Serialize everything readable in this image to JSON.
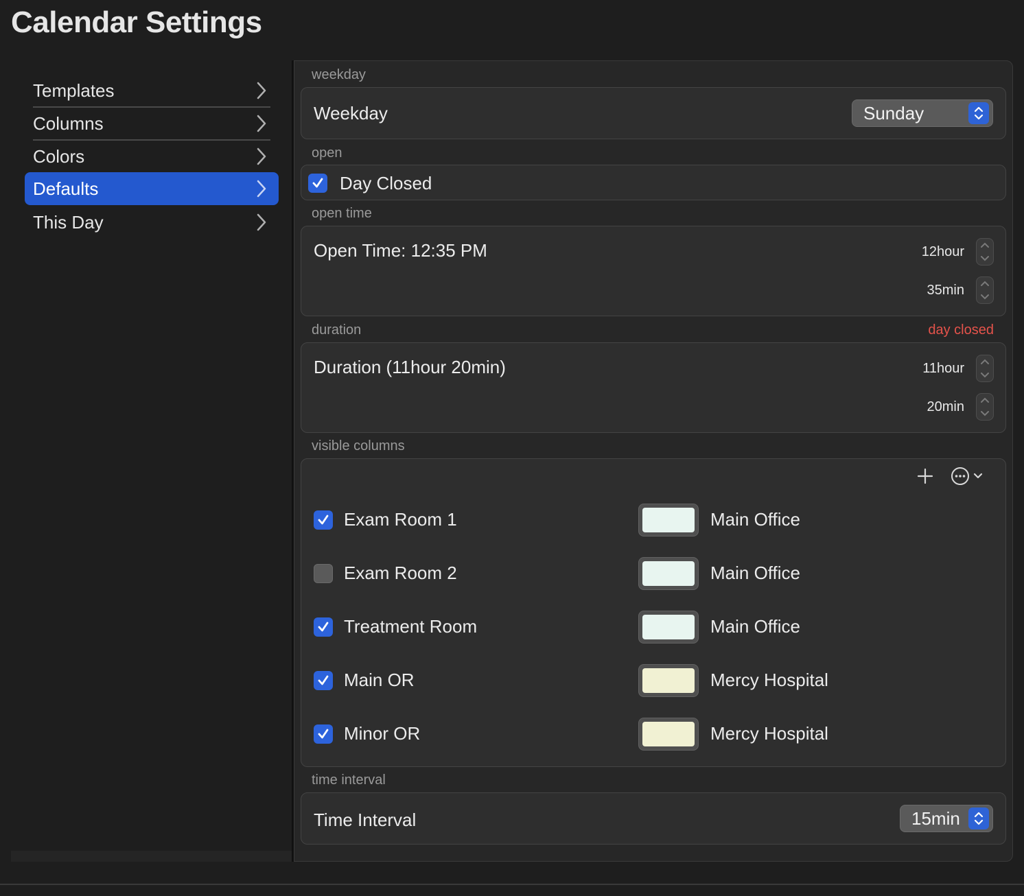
{
  "window": {
    "title": "Calendar Settings"
  },
  "sidebar": {
    "items": [
      {
        "label": "Templates",
        "selected": false
      },
      {
        "label": "Columns",
        "selected": false
      },
      {
        "label": "Colors",
        "selected": false
      },
      {
        "label": "Defaults",
        "selected": true
      },
      {
        "label": "This Day",
        "selected": false
      }
    ]
  },
  "sections": {
    "weekday": {
      "label": "weekday",
      "title": "Weekday",
      "value": "Sunday"
    },
    "open": {
      "label": "open",
      "checkbox_label": "Day Closed",
      "checked": true
    },
    "open_time": {
      "label": "open time",
      "title": "Open Time: 12:35 PM",
      "hour_label": "12hour",
      "minute_label": "35min"
    },
    "duration": {
      "label": "duration",
      "warning": "day closed",
      "title": "Duration (11hour 20min)",
      "hour_label": "11hour",
      "minute_label": "20min"
    },
    "visible_columns": {
      "label": "visible columns",
      "toolbar": {
        "add_icon": "plus-icon",
        "more_icon": "ellipsis-circle-icon"
      },
      "rows": [
        {
          "name": "Exam Room 1",
          "checked": true,
          "color": "#e8f5f0",
          "location": "Main Office"
        },
        {
          "name": "Exam Room 2",
          "checked": false,
          "color": "#e8f5f0",
          "location": "Main Office"
        },
        {
          "name": "Treatment Room",
          "checked": true,
          "color": "#e8f5f0",
          "location": "Main Office"
        },
        {
          "name": "Main OR",
          "checked": true,
          "color": "#f1f1d3",
          "location": "Mercy Hospital"
        },
        {
          "name": "Minor OR",
          "checked": true,
          "color": "#f1f1d3",
          "location": "Mercy Hospital"
        }
      ]
    },
    "time_interval": {
      "label": "time interval",
      "title": "Time Interval",
      "value": "15min"
    }
  },
  "colors": {
    "accent": "#2459cf",
    "warning": "#e5534b",
    "background": "#1e1e1e"
  }
}
